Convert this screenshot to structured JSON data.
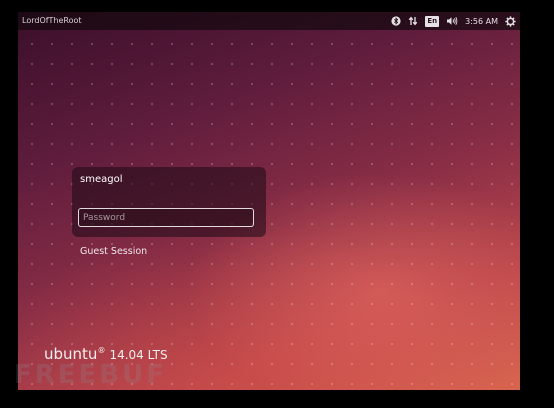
{
  "topbar": {
    "hostname": "LordOfTheRoot",
    "keyboard_layout": "En",
    "clock": "3:56 AM",
    "icons": [
      "bluetooth-icon",
      "network-icon",
      "volume-icon",
      "gear-icon"
    ]
  },
  "login": {
    "username": "smeagol",
    "password_placeholder": "Password",
    "guest_label": "Guest Session"
  },
  "branding": {
    "word": "ubuntu",
    "registered": "®",
    "version": "14.04 LTS"
  },
  "watermark": {
    "text": "FREEBUF"
  },
  "colors": {
    "background_dark": "#3a0f2a",
    "background_mid": "#8a2e46",
    "background_light": "#d9654f",
    "topbar": "#14080e"
  }
}
